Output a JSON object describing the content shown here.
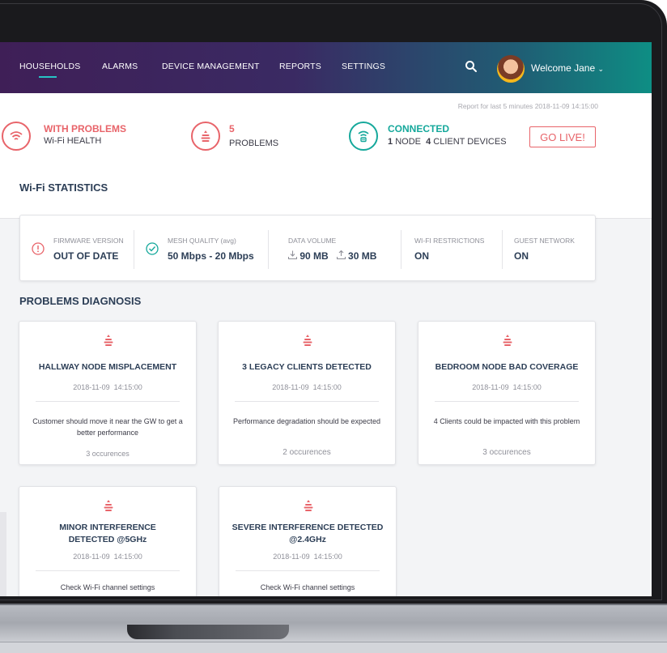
{
  "nav": {
    "items": [
      {
        "label": "HOUSEHOLDS",
        "active": true
      },
      {
        "label": "ALARMS"
      },
      {
        "label": "DEVICE MANAGEMENT"
      },
      {
        "label": "REPORTS"
      },
      {
        "label": "SETTINGS"
      }
    ],
    "welcome": "Welcome Jane",
    "welcome_caret": "⌄",
    "accent_color": "#27c3c5"
  },
  "summary": {
    "report_text": "Report for last 5 minutes",
    "report_date": "2018-11-09 14:15:00",
    "health": {
      "title": "WITH PROBLEMS",
      "subtitle": "Wi-Fi HEALTH",
      "color": "#e8646a",
      "icon": "wifi-icon"
    },
    "problems": {
      "count": "5",
      "label": "PROBLEMS",
      "color": "#e8646a",
      "icon": "problem-stack-icon"
    },
    "connection": {
      "title": "CONNECTED",
      "nodes": "1",
      "nodes_label": "NODE",
      "clients": "4",
      "clients_label": "CLIENT DEVICES",
      "color": "#15a89b",
      "icon": "router-icon"
    },
    "go_live": "GO LIVE!"
  },
  "wifi_stats": {
    "title": "Wi-Fi STATISTICS",
    "firmware": {
      "label": "FIRMWARE VERSION",
      "value": "OUT OF DATE",
      "icon": "warning-circle-icon"
    },
    "mesh": {
      "label": "MESH QUALITY (avg)",
      "value": "50 Mbps - 20 Mbps",
      "icon": "check-circle-icon"
    },
    "data_volume": {
      "label": "DATA VOLUME",
      "download": "90 MB",
      "upload": "30 MB"
    },
    "restrictions": {
      "label": "WI-FI RESTRICTIONS",
      "value": "ON"
    },
    "guest": {
      "label": "GUEST NETWORK",
      "value": "ON"
    }
  },
  "diagnosis": {
    "title": "PROBLEMS DIAGNOSIS",
    "cards": [
      {
        "title": "HALLWAY NODE MISPLACEMENT",
        "date": "2018-11-09",
        "time": "14:15:00",
        "description": "Customer should move it near the GW to get a better performance",
        "occurrences": "3 occurences"
      },
      {
        "title": "3 LEGACY CLIENTS DETECTED",
        "date": "2018-11-09",
        "time": "14:15:00",
        "description": "Performance degradation should be expected",
        "occurrences": "2 occurences"
      },
      {
        "title": "BEDROOM NODE BAD COVERAGE",
        "date": "2018-11-09",
        "time": "14:15:00",
        "description": "4 Clients could be impacted with this problem",
        "occurrences": "3 occurences"
      },
      {
        "title": "MINOR INTERFERENCE DETECTED @5GHz",
        "date": "2018-11-09",
        "time": "14:15:00",
        "description": "Check Wi-Fi channel settings",
        "occurrences": ""
      },
      {
        "title": "SEVERE INTERFERENCE DETECTED @2.4GHz",
        "date": "2018-11-09",
        "time": "14:15:00",
        "description": "Check Wi-Fi channel settings",
        "occurrences": ""
      }
    ]
  }
}
